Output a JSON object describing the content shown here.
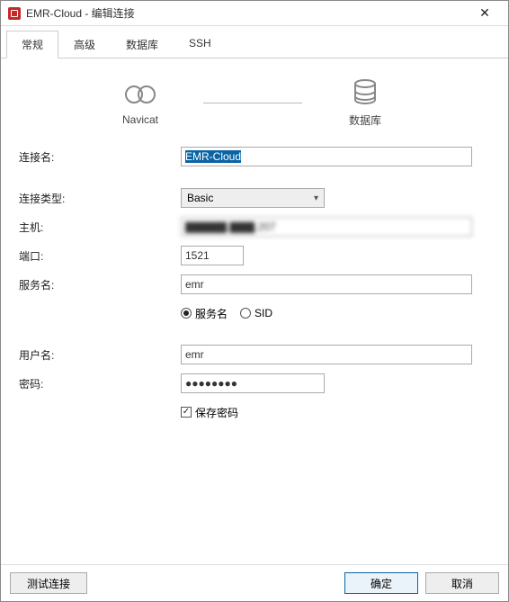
{
  "titlebar": {
    "title": "EMR-Cloud - 编辑连接"
  },
  "tabs": {
    "general": "常规",
    "advanced": "高级",
    "database": "数据库",
    "ssh": "SSH"
  },
  "diagram": {
    "navicat": "Navicat",
    "db": "数据库"
  },
  "labels": {
    "conn_name": "连接名:",
    "conn_type": "连接类型:",
    "host": "主机:",
    "port": "端口:",
    "service": "服务名:",
    "username": "用户名:",
    "password": "密码:"
  },
  "values": {
    "conn_name": "EMR-Cloud",
    "type": "Basic",
    "host_obscured": "▇▇▇▇▇.▇▇▇.207",
    "port": "1521",
    "service": "emr",
    "username": "emr",
    "password": "●●●●●●●●"
  },
  "radios": {
    "service": "服务名",
    "sid": "SID"
  },
  "checkbox": {
    "save_password": "保存密码"
  },
  "buttons": {
    "test": "测试连接",
    "ok": "确定",
    "cancel": "取消"
  }
}
